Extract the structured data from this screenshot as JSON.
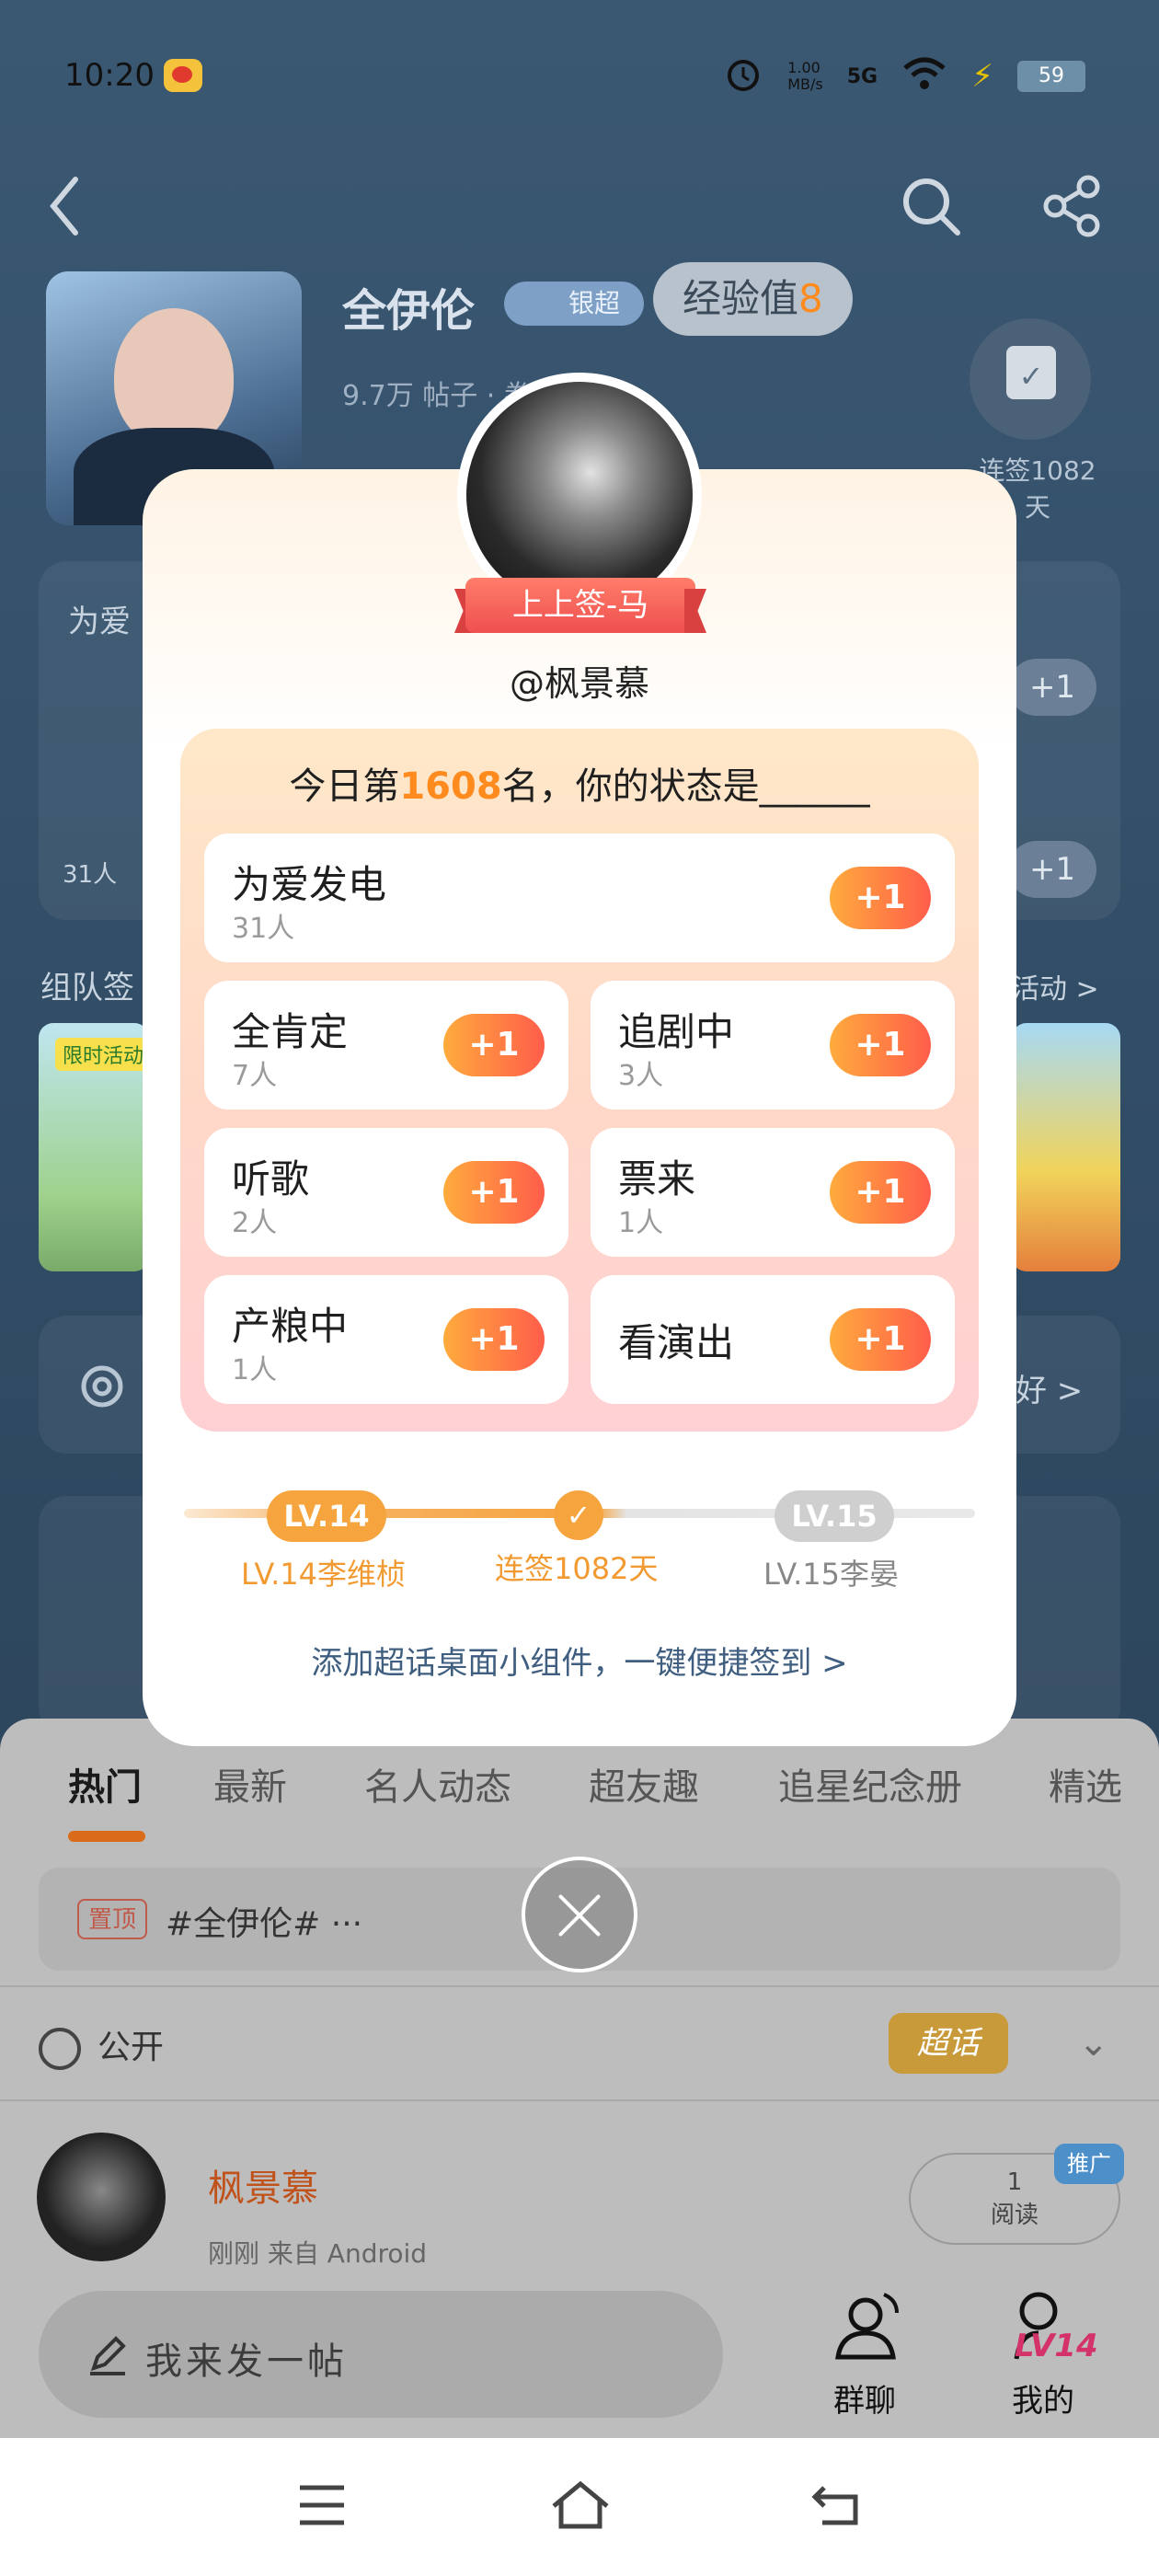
{
  "status_bar": {
    "time": "10:20",
    "net_speed": "1.00\nMB/s",
    "signal": "5G",
    "battery": "59"
  },
  "community": {
    "name": "全伊伦",
    "tier_badge": "银超",
    "exp_label": "经验值",
    "exp_value": "8",
    "stats": "9.7万  帖子  ·  拳超人 >",
    "checkin_days_label": "连签1082天",
    "section_love": "为爱",
    "section_love_count": "31人",
    "team_label": "组队签",
    "activity_link": "活动 >",
    "limited_tag": "限时活动",
    "prefs_link": "好 >"
  },
  "modal": {
    "ribbon": "上上签-马",
    "username": "@枫景慕",
    "question_prefix": "今日第",
    "rank": "1608",
    "question_suffix": "名，你的状态是______",
    "plus_label": "+1",
    "options": [
      {
        "title": "为爱发电",
        "count": "31人"
      },
      {
        "title": "全肯定",
        "count": "7人"
      },
      {
        "title": "追剧中",
        "count": "3人"
      },
      {
        "title": "听歌",
        "count": "2人"
      },
      {
        "title": "票来",
        "count": "1人"
      },
      {
        "title": "产粮中",
        "count": "1人"
      },
      {
        "title": "看演出",
        "count": ""
      }
    ],
    "level_current": "LV.14",
    "level_next": "LV.15",
    "level_current_title": "LV.14李维桢",
    "streak_label": "连签1082天",
    "level_next_title": "LV.15李晏",
    "widget_link": "添加超话桌面小组件，一键便捷签到 >"
  },
  "feed": {
    "tabs": [
      "热门",
      "最新",
      "名人动态",
      "超友趣",
      "追星纪念册",
      "精选"
    ],
    "pinned_tag": "置顶",
    "pinned_text": "#全伊伦# ···",
    "visibility": "公开",
    "supertalk_tag": "超话",
    "post_author": "枫景慕",
    "post_meta": "刚刚  来自  Android",
    "read_count": "1",
    "read_label": "阅读",
    "promo_tag": "推广",
    "compose_placeholder": "我来发一帖",
    "nav_group_chat": "群聊",
    "nav_mine": "我的",
    "nav_mine_level": "LV14"
  },
  "colors": {
    "accent": "#ff8a1d",
    "plus_gradient_start": "#ffab3d",
    "plus_gradient_end": "#ff5d4a",
    "ribbon": "#ef4f4f"
  },
  "icons": [
    "back-icon",
    "search-icon",
    "share-icon",
    "calendar-check-icon",
    "gear-icon",
    "globe-icon",
    "chevron-down-icon",
    "pencil-icon",
    "group-chat-icon",
    "profile-icon",
    "menu-icon",
    "home-icon",
    "back-nav-icon",
    "close-icon"
  ]
}
